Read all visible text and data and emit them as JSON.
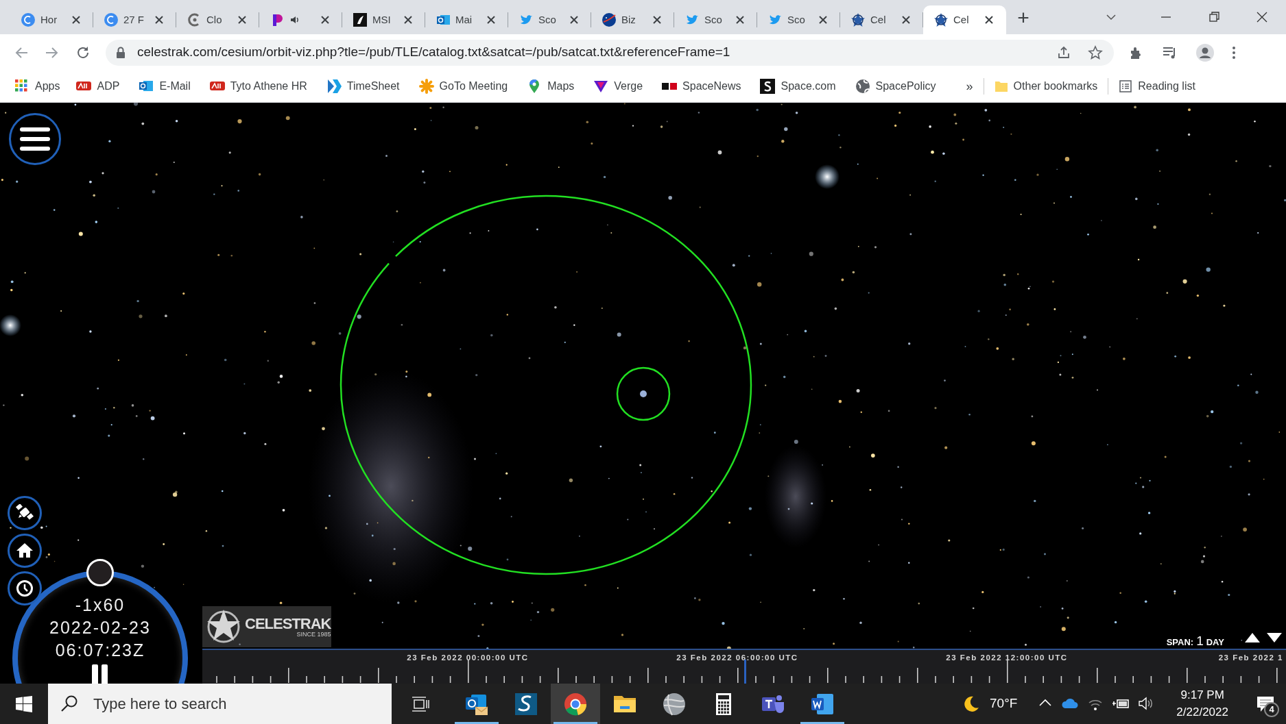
{
  "browser": {
    "tabs": [
      {
        "label": "Hor",
        "audio": false,
        "selected": false
      },
      {
        "label": "27 F",
        "audio": false,
        "selected": false
      },
      {
        "label": "Clo",
        "audio": false,
        "selected": false
      },
      {
        "audio": true,
        "selected": false
      },
      {
        "label": "MSI",
        "audio": false,
        "selected": false
      },
      {
        "label": "Mai",
        "audio": false,
        "selected": false
      },
      {
        "label": "Sco",
        "audio": false,
        "selected": false
      },
      {
        "label": "Biz",
        "audio": false,
        "selected": false
      },
      {
        "label": "Sco",
        "audio": false,
        "selected": false
      },
      {
        "label": "Sco",
        "audio": false,
        "selected": false
      },
      {
        "label": "Cel",
        "audio": false,
        "selected": false
      },
      {
        "label": "Cel",
        "audio": false,
        "selected": true
      }
    ],
    "new_tab": "+",
    "address": "celestrak.com/cesium/orbit-viz.php?tle=/pub/TLE/catalog.txt&satcat=/pub/satcat.txt&referenceFrame=1",
    "bookmarks": [
      {
        "label": "Apps"
      },
      {
        "label": "ADP"
      },
      {
        "label": "E-Mail"
      },
      {
        "label": "Tyto Athene HR"
      },
      {
        "label": "TimeSheet"
      },
      {
        "label": "GoTo Meeting"
      },
      {
        "label": "Maps"
      },
      {
        "label": "Verge"
      },
      {
        "label": "SpaceNews"
      },
      {
        "label": "Space.com"
      },
      {
        "label": "SpacePolicy"
      }
    ],
    "more": "»",
    "other_bookmarks": "Other bookmarks",
    "reading_list": "Reading list"
  },
  "viewer": {
    "clock": {
      "speed": "-1x60",
      "date": "2022-02-23",
      "time": "06:07:23Z"
    },
    "logo": {
      "name": "CELESTRAK",
      "tagline": "SINCE 1985"
    },
    "span": {
      "label": "SPAN:",
      "value": "1",
      "unit": "DAY"
    },
    "timeline": {
      "labels": [
        "23 Feb 2022 00:00:00 UTC",
        "23 Feb 2022 06:00:00 UTC",
        "23 Feb 2022 12:00:00 UTC",
        "23 Feb 2022 1"
      ],
      "level": 0.5
    }
  },
  "taskbar": {
    "search": {
      "placeholder": "Type here to search"
    },
    "apps": [
      {
        "running": true,
        "selected": false
      },
      {
        "running": false,
        "selected": false
      },
      {
        "running": true,
        "selected": true
      },
      {
        "running": false,
        "selected": false
      },
      {
        "running": false,
        "selected": false
      },
      {
        "running": false,
        "selected": false
      },
      {
        "running": false,
        "selected": false
      },
      {
        "running": true,
        "selected": false
      }
    ],
    "weather": "70°F",
    "time": "9:17 PM",
    "date": "2/22/2022",
    "notifications": "4"
  }
}
